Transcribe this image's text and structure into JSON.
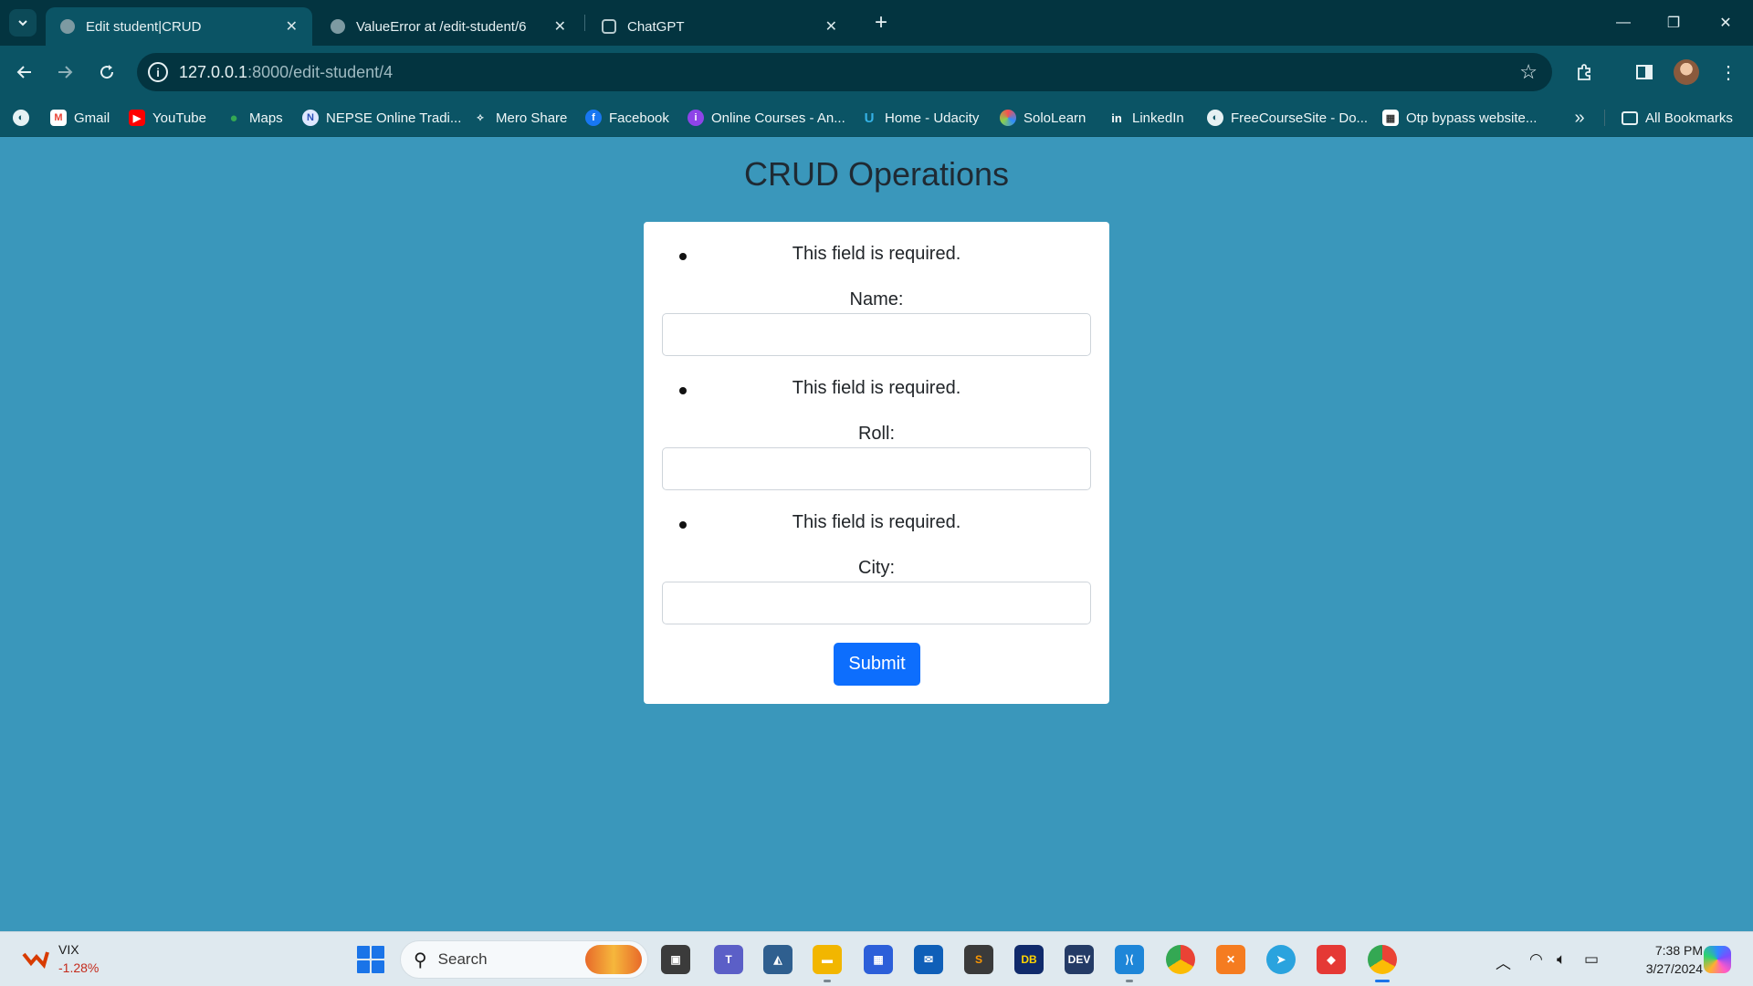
{
  "browser": {
    "tabs": [
      {
        "title": "Edit student|CRUD",
        "active": true
      },
      {
        "title": "ValueError at /edit-student/6",
        "active": false
      },
      {
        "title": "ChatGPT",
        "active": false
      }
    ],
    "url_host": "127.0.0.1",
    "url_path": ":8000/edit-student/4",
    "bookmarks": [
      {
        "label": "Gmail",
        "icon": "gmail-icon"
      },
      {
        "label": "YouTube",
        "icon": "youtube-icon"
      },
      {
        "label": "Maps",
        "icon": "maps-icon"
      },
      {
        "label": "NEPSE Online Tradi...",
        "icon": "nepse-icon"
      },
      {
        "label": "Mero Share",
        "icon": "mero-share-icon"
      },
      {
        "label": "Facebook",
        "icon": "facebook-icon"
      },
      {
        "label": "Online Courses - An...",
        "icon": "online-courses-icon"
      },
      {
        "label": "Home - Udacity",
        "icon": "udacity-icon"
      },
      {
        "label": "SoloLearn",
        "icon": "sololearn-icon"
      },
      {
        "label": "LinkedIn",
        "icon": "linkedin-icon"
      },
      {
        "label": "FreeCourseSite - Do...",
        "icon": "freecoursesite-icon"
      },
      {
        "label": "Otp bypass website...",
        "icon": "otp-bypass-icon"
      }
    ],
    "all_bookmarks": "All Bookmarks"
  },
  "page": {
    "title": "CRUD Operations",
    "fields": [
      {
        "error": "This field is required.",
        "label": "Name:",
        "value": ""
      },
      {
        "error": "This field is required.",
        "label": "Roll:",
        "value": ""
      },
      {
        "error": "This field is required.",
        "label": "City:",
        "value": ""
      }
    ],
    "submit_label": "Submit"
  },
  "taskbar": {
    "widget_name": "VIX",
    "widget_value": "-1.28%",
    "search_placeholder": "Search",
    "time": "7:38 PM",
    "date": "3/27/2024"
  },
  "colors": {
    "page_background": "#3a97bb",
    "submit_button": "#0d6efd",
    "chrome_dark": "#033440",
    "chrome_toolbar": "#0b5465"
  }
}
